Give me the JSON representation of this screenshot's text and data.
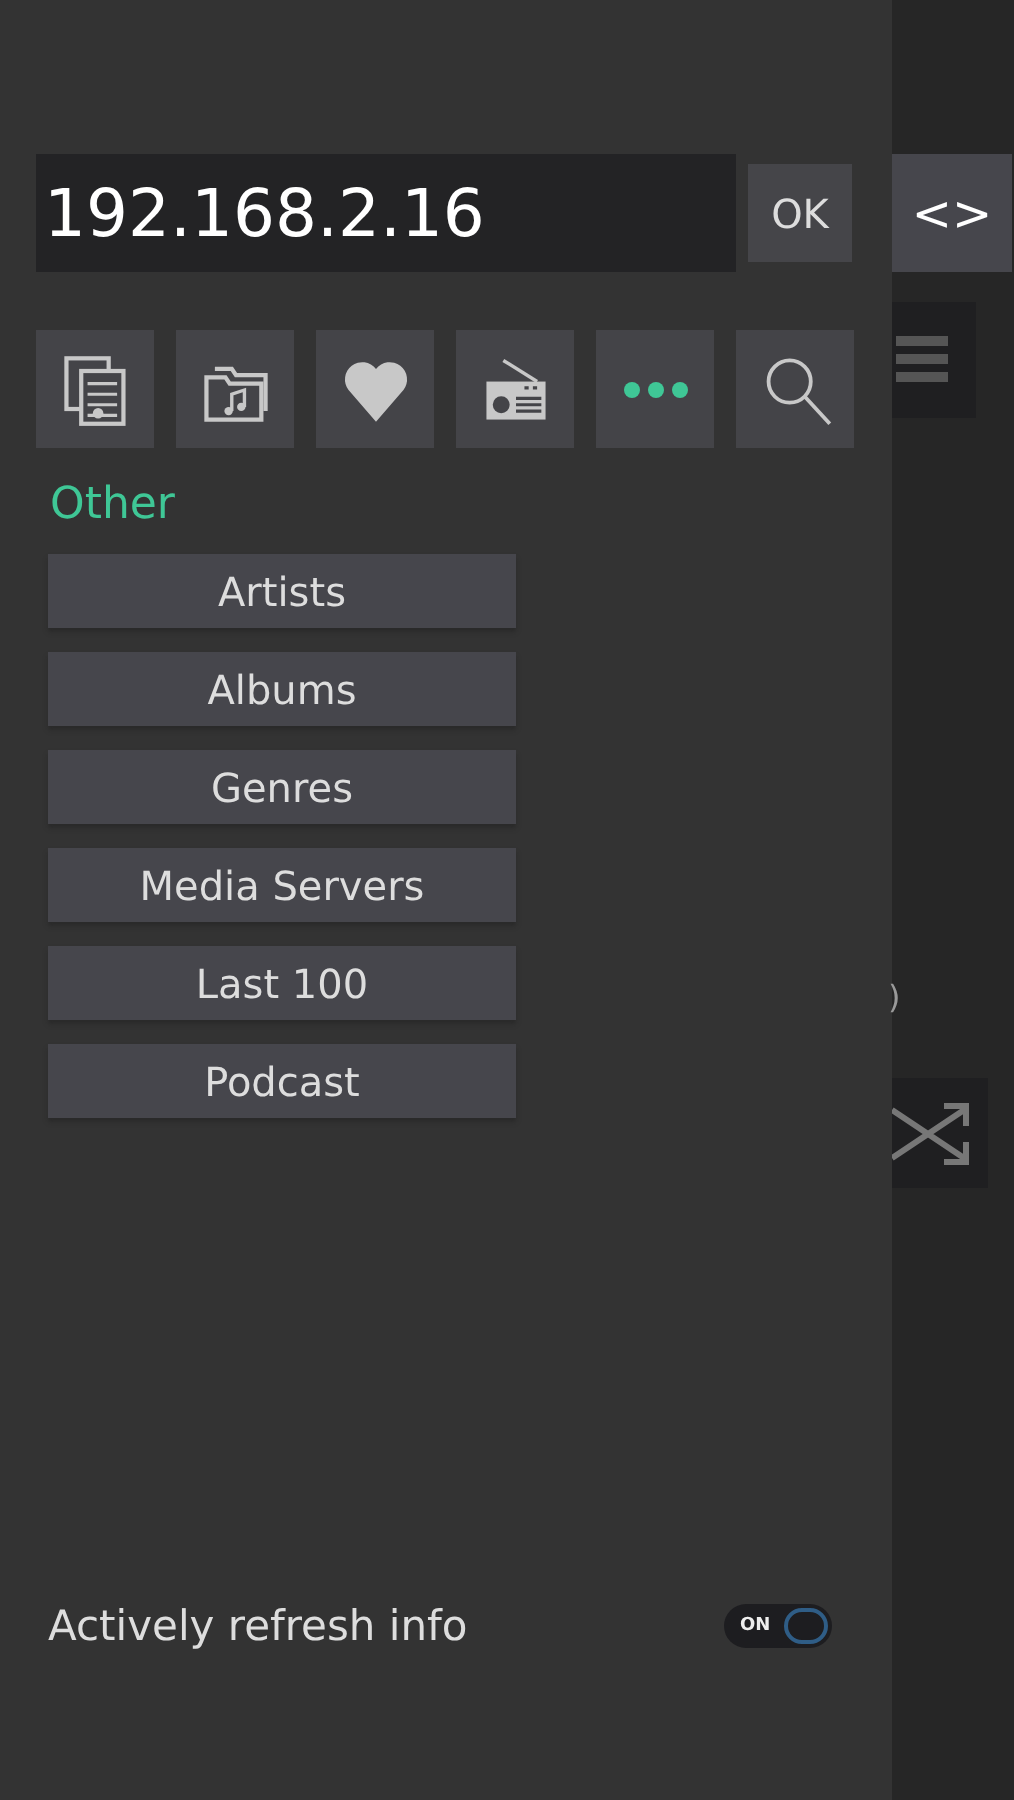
{
  "server": {
    "address": "192.168.2.16",
    "ok_button": "OK"
  },
  "side_button": "<>",
  "source_tabs": [
    {
      "kind": "library",
      "selected": false
    },
    {
      "kind": "folders",
      "selected": false
    },
    {
      "kind": "favorites",
      "selected": false
    },
    {
      "kind": "radio",
      "selected": false
    },
    {
      "kind": "more",
      "selected": true
    },
    {
      "kind": "search",
      "selected": false
    }
  ],
  "section_title": "Other",
  "menu_items": [
    "Artists",
    "Albums",
    "Genres",
    "Media Servers",
    "Last 100",
    "Podcast"
  ],
  "background_fragment": ")",
  "refresh_setting": {
    "label": "Actively refresh info",
    "on": true,
    "toggle_text": "ON"
  }
}
